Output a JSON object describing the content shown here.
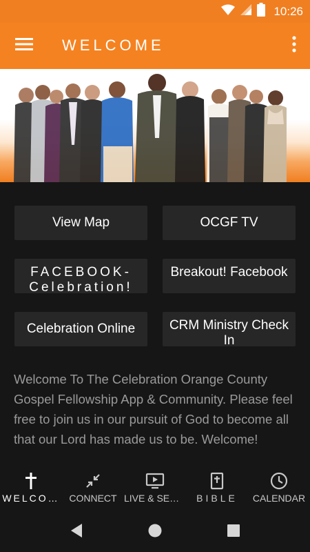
{
  "status_bar": {
    "time": "10:26",
    "icons": [
      "wifi-icon",
      "cell-signal-icon",
      "battery-icon"
    ]
  },
  "app_bar": {
    "title": "WELCOME",
    "background": "#f58220",
    "icons": [
      "menu-icon",
      "overflow-menu-icon"
    ]
  },
  "hero": {
    "description_icon": "group-photo"
  },
  "tiles": [
    {
      "label": "View Map"
    },
    {
      "label": "OCGF TV"
    },
    {
      "label": "FACEBOOK-Celebration!"
    },
    {
      "label": "Breakout! Facebook"
    },
    {
      "label": "Celebration Online"
    },
    {
      "label": "CRM Ministry Check In"
    }
  ],
  "welcome_message": "Welcome To The Celebration Orange County Gospel Fellowship App & Community.  Please feel free to join us in our pursuit of God to become all that our Lord has made us to be. Welcome!",
  "bottom_nav": [
    {
      "label": "WELCO…",
      "icon": "cross-icon",
      "active": true
    },
    {
      "label": "CONNECT",
      "icon": "connect-arrows-icon",
      "active": false
    },
    {
      "label": "LIVE & SER…",
      "icon": "tv-play-icon",
      "active": false
    },
    {
      "label": "BIBLE",
      "icon": "bible-icon",
      "active": false
    },
    {
      "label": "CALENDAR",
      "icon": "clock-icon",
      "active": false
    }
  ],
  "system_nav": [
    "back-icon",
    "home-icon",
    "recents-icon"
  ],
  "colors": {
    "accent": "#f58220",
    "background": "#161616",
    "tile": "#272727",
    "body_text": "#9a9a9a"
  }
}
